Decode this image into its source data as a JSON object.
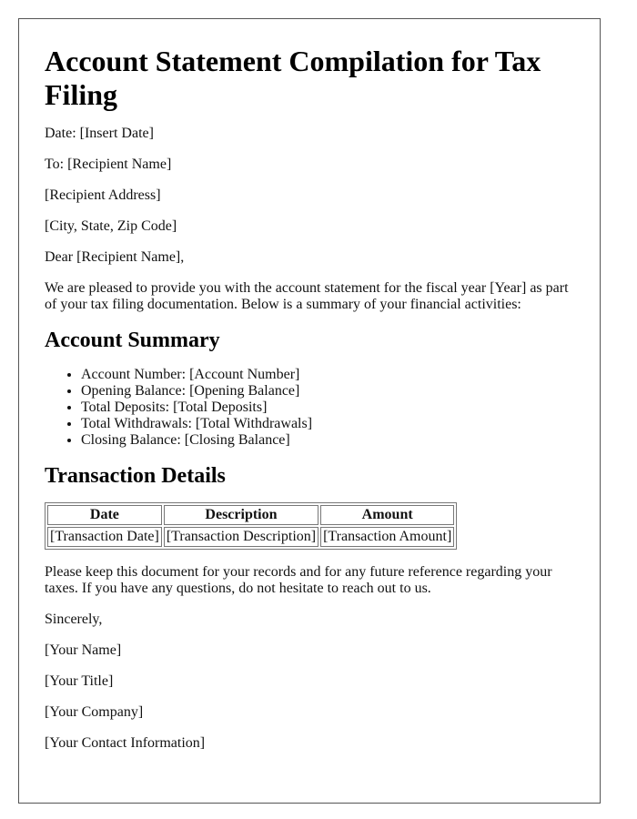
{
  "title": "Account Statement Compilation for Tax Filing",
  "header_lines": {
    "date": "Date: [Insert Date]",
    "to": "To: [Recipient Name]",
    "address": "[Recipient Address]",
    "city": "[City, State, Zip Code]",
    "salutation": "Dear [Recipient Name],"
  },
  "intro": "We are pleased to provide you with the account statement for the fiscal year [Year] as part of your tax filing documentation. Below is a summary of your financial activities:",
  "summary": {
    "heading": "Account Summary",
    "items": [
      "Account Number: [Account Number]",
      "Opening Balance: [Opening Balance]",
      "Total Deposits: [Total Deposits]",
      "Total Withdrawals: [Total Withdrawals]",
      "Closing Balance: [Closing Balance]"
    ]
  },
  "transactions": {
    "heading": "Transaction Details",
    "columns": [
      "Date",
      "Description",
      "Amount"
    ],
    "rows": [
      [
        "[Transaction Date]",
        "[Transaction Description]",
        "[Transaction Amount]"
      ]
    ]
  },
  "closing_paragraph": "Please keep this document for your records and for any future reference regarding your taxes. If you have any questions, do not hesitate to reach out to us.",
  "signoff": {
    "closing": "Sincerely,",
    "name": "[Your Name]",
    "title": "[Your Title]",
    "company": "[Your Company]",
    "contact": "[Your Contact Information]"
  }
}
